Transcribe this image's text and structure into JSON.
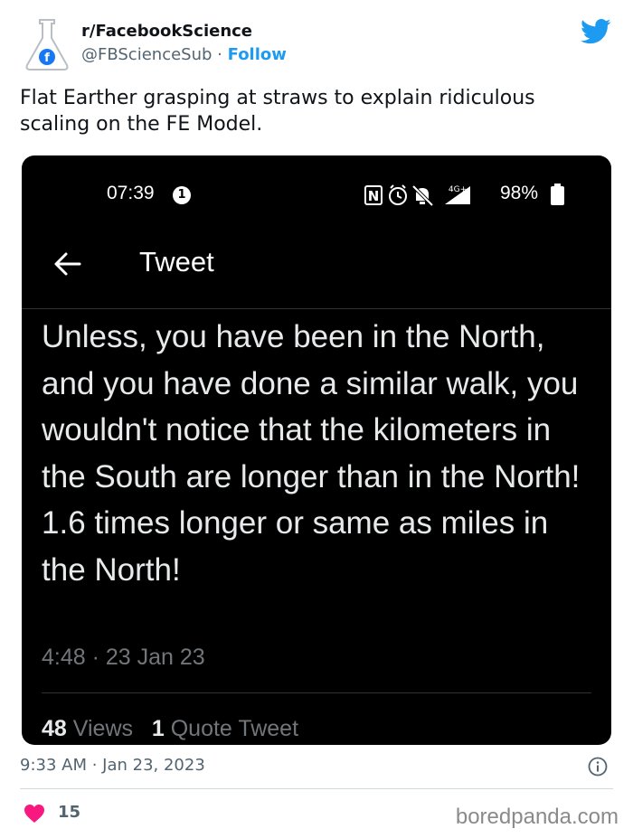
{
  "author": {
    "display_name": "r/FacebookScience",
    "handle": "@FBScienceSub",
    "separator": "·",
    "follow_label": "Follow"
  },
  "tweet": {
    "text": "Flat Earther grasping at straws to explain ridiculous scaling on the FE Model.",
    "timestamp": "9:33 AM · Jan 23, 2023",
    "likes": "15"
  },
  "screenshot": {
    "status_time": "07:39",
    "notification_count": "1",
    "network": "4G+",
    "battery": "98%",
    "header_title": "Tweet",
    "text": "Unless, you have been in the North, and you have done a similar walk, you wouldn't notice that the kilometers in the South are longer than in the North! 1.6 times longer or same as miles in the North!",
    "date": "4:48 · 23 Jan 23",
    "views_count": "48",
    "views_label": "Views",
    "quotes_count": "1",
    "quotes_label": "Quote Tweet"
  },
  "watermark": "boredpanda.com",
  "colors": {
    "brand": "#1d9bf0",
    "like": "#f91880",
    "screenshot_bg": "#000000"
  }
}
